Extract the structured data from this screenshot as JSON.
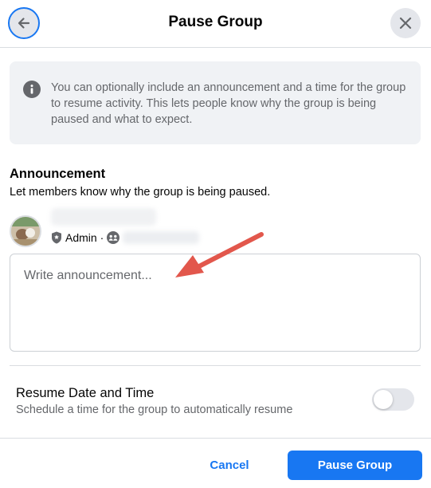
{
  "dialog": {
    "title": "Pause Group",
    "back_icon": "arrow-left-icon",
    "close_icon": "close-icon"
  },
  "info": {
    "icon": "info-icon",
    "text": "You can optionally include an announcement and a time for the group to resume activity. This lets people know why the group is being paused and what to expect."
  },
  "announcement": {
    "heading": "Announcement",
    "subtitle": "Let members know why the group is being paused.",
    "poster": {
      "role": "Admin ·",
      "role_icon": "shield-icon",
      "group_icon": "group-icon"
    },
    "placeholder": "Write announcement..."
  },
  "resume": {
    "title": "Resume Date and Time",
    "subtitle": "Schedule a time for the group to automatically resume",
    "toggle_on": false
  },
  "footer": {
    "cancel_label": "Cancel",
    "pause_label": "Pause Group"
  },
  "colors": {
    "accent": "#1877f2",
    "annotation_arrow": "#e2574c"
  }
}
